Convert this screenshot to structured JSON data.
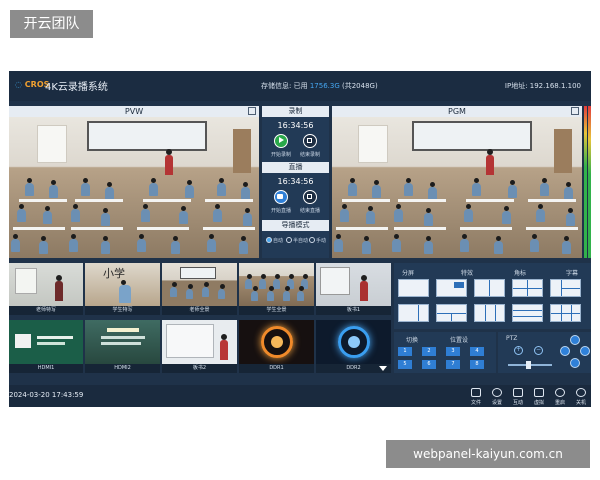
{
  "watermark": {
    "top": "开云团队",
    "bottom": "webpanel-kaiyun.com.cn"
  },
  "header": {
    "logo": "CROS",
    "title": "4K云录播系统",
    "storage_label": "存储信息: 已用",
    "storage_used": "1756.3G",
    "storage_total": "(共2048G)",
    "ip": "IP地址: 192.168.1.100"
  },
  "pvw": {
    "label": "PVW"
  },
  "pgm": {
    "label": "PGM"
  },
  "record": {
    "title": "录制",
    "time": "16:34:56",
    "start_label": "开始录制",
    "stop_label": "结束录制"
  },
  "live": {
    "title": "直播",
    "time": "16:34:56",
    "start_label": "开始直播",
    "stop_label": "结束直播"
  },
  "director": {
    "title": "导播模式",
    "options": [
      "自动",
      "半自动",
      "手动"
    ],
    "selected": 0
  },
  "thumbnails": [
    {
      "label": "老师特写"
    },
    {
      "label": "学生特写"
    },
    {
      "label": "老师全景"
    },
    {
      "label": "学生全景"
    },
    {
      "label": "板书1"
    },
    {
      "label": "HDMI1"
    },
    {
      "label": "HDMI2"
    },
    {
      "label": "板书2"
    },
    {
      "label": "DDR1"
    },
    {
      "label": "DDR2"
    }
  ],
  "layout_tabs": [
    "分屏",
    "特效",
    "角标",
    "字幕"
  ],
  "switch": {
    "titles": [
      "切换",
      "位置设"
    ],
    "buttons": [
      "1",
      "2",
      "3",
      "4",
      "5",
      "6",
      "7",
      "8"
    ]
  },
  "ptz": {
    "title": "PTZ"
  },
  "footer": {
    "datetime": "2024-03-20  17:43:59",
    "buttons": [
      "文件",
      "设置",
      "互动",
      "虚拟",
      "重启",
      "关机"
    ]
  },
  "colors": {
    "accent": "#2f80d8",
    "record": "#2aa84a",
    "panel": "#1f3249"
  }
}
